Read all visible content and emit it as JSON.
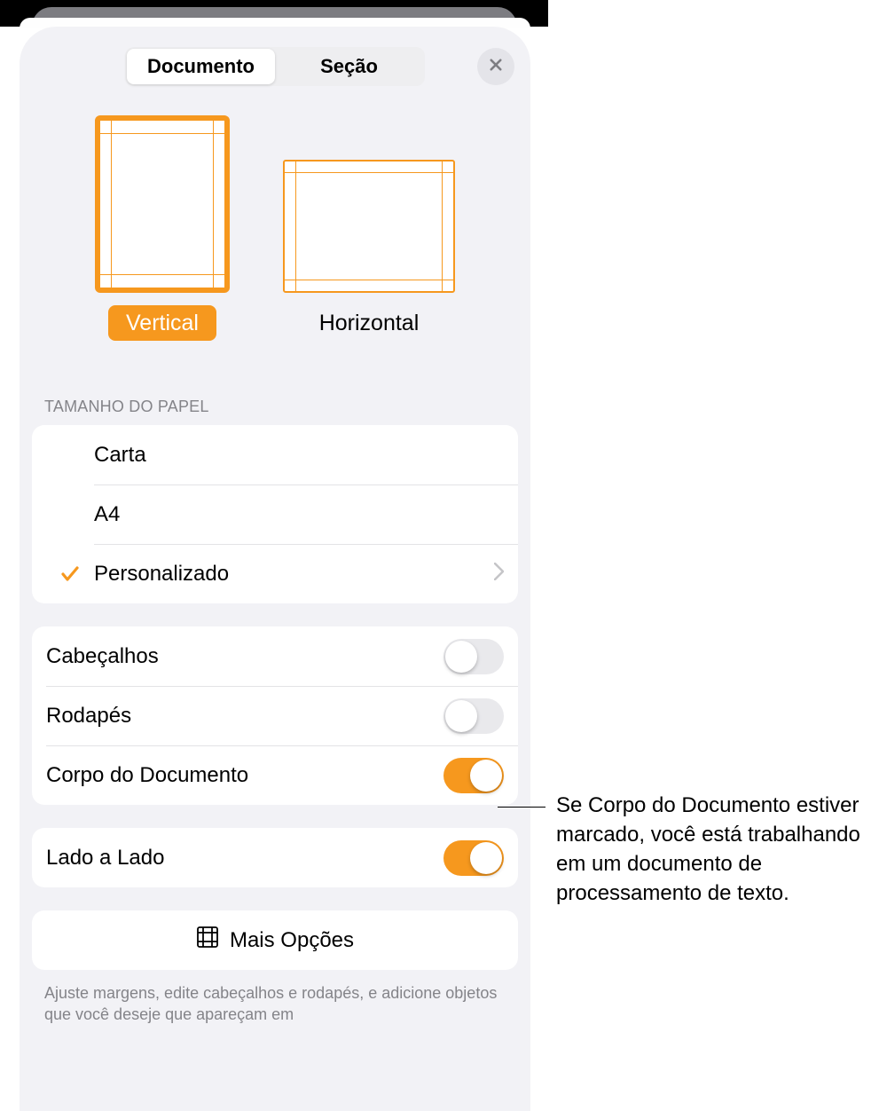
{
  "header": {
    "tabs": {
      "documento": "Documento",
      "secao": "Seção"
    }
  },
  "orientation": {
    "vertical": "Vertical",
    "horizontal": "Horizontal"
  },
  "paper": {
    "section_title": "TAMANHO DO PAPEL",
    "carta": "Carta",
    "a4": "A4",
    "personalizado": "Personalizado"
  },
  "toggles": {
    "cabecalhos": "Cabeçalhos",
    "rodapes": "Rodapés",
    "corpo": "Corpo do Documento",
    "lado_a_lado": "Lado a Lado"
  },
  "more": {
    "label": "Mais Opções",
    "footnote": "Ajuste margens, edite cabeçalhos e rodapés, e adicione objetos que você deseje que apareçam em"
  },
  "callout": "Se Corpo do Documento estiver marcado, você está trabalhando em um documento de processamento de texto."
}
